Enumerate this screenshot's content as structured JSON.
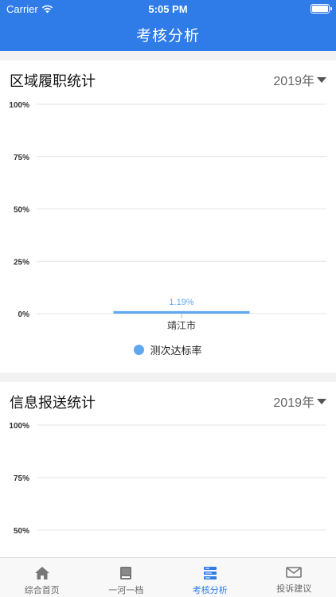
{
  "status": {
    "carrier": "Carrier",
    "time": "5:05 PM"
  },
  "nav": {
    "title": "考核分析"
  },
  "colors": {
    "primary": "#2f7be8",
    "series": "#5fa8f0"
  },
  "section1": {
    "title": "区域履职统计",
    "year": "2019年",
    "legend": "测次达标率"
  },
  "section2": {
    "title": "信息报送统计",
    "year": "2019年"
  },
  "chart_data": [
    {
      "type": "bar",
      "categories": [
        "靖江市"
      ],
      "series": [
        {
          "name": "测次达标率",
          "values": [
            1.19
          ]
        }
      ],
      "data_labels": [
        "1.19%"
      ],
      "yticks": [
        "0%",
        "25%",
        "50%",
        "75%",
        "100%"
      ],
      "ylim": [
        0,
        100
      ],
      "grid": true,
      "legend": "bottom"
    },
    {
      "type": "bar",
      "categories": [],
      "series": [],
      "yticks": [
        "50%",
        "75%",
        "100%"
      ],
      "ylim": [
        0,
        100
      ],
      "grid": true
    }
  ],
  "tabs": [
    {
      "label": "综合首页",
      "icon": "home-icon",
      "active": false
    },
    {
      "label": "一河一档",
      "icon": "book-icon",
      "active": false
    },
    {
      "label": "考核分析",
      "icon": "analysis-icon",
      "active": true
    },
    {
      "label": "投诉建议",
      "icon": "mail-icon",
      "active": false
    }
  ]
}
